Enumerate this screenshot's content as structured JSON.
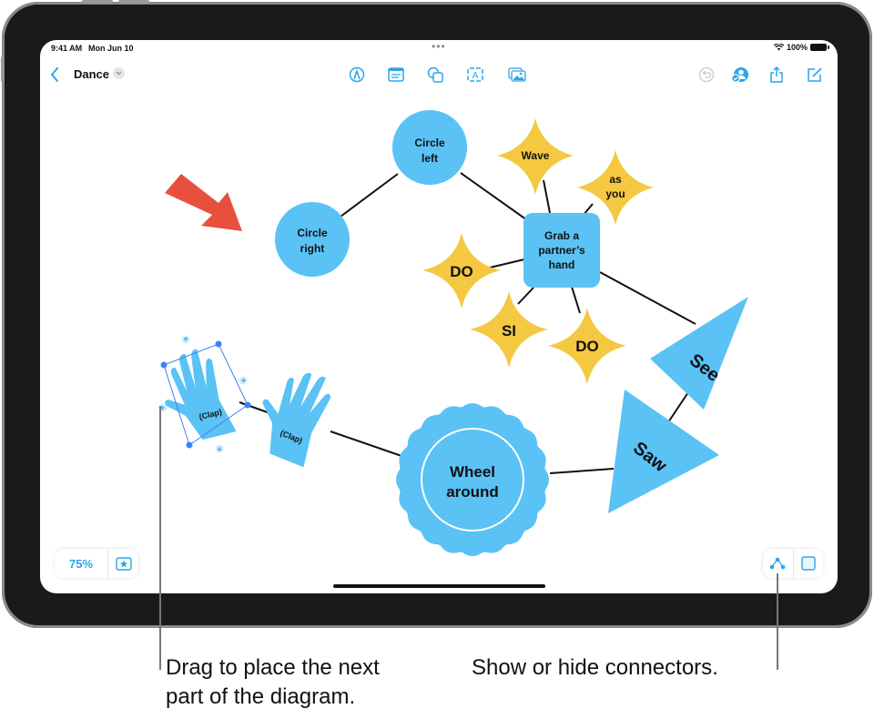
{
  "status_bar": {
    "time": "9:41 AM",
    "date": "Mon Jun 10",
    "battery": "100%",
    "more_dots": "•••"
  },
  "toolbar": {
    "back_icon": "chevron-left-icon",
    "board_title": "Dance",
    "title_menu_icon": "chevron-down-icon",
    "center_tools": [
      "pen-icon",
      "sticky-note-icon",
      "shapes-icon",
      "text-box-icon",
      "media-icon"
    ],
    "right_tools": [
      "undo-icon",
      "collaborate-icon",
      "share-icon",
      "compose-icon"
    ]
  },
  "diagram": {
    "nodes": {
      "circle_left": "Circle left",
      "circle_left_l1": "Circle",
      "circle_left_l2": "left",
      "circle_right_l1": "Circle",
      "circle_right_l2": "right",
      "wave": "Wave",
      "as_you_l1": "as",
      "as_you_l2": "you",
      "grab_l1": "Grab a",
      "grab_l2": "partner’s",
      "grab_l3": "hand",
      "do_1": "DO",
      "si": "SI",
      "do_2": "DO",
      "see": "See",
      "saw": "Saw",
      "wheel_l1": "Wheel",
      "wheel_l2": "around",
      "clap_1": "(Clap)",
      "clap_2": "(Clap)"
    },
    "colors": {
      "blue_shape": "#5ac2f5",
      "yellow_shape": "#f5c842",
      "red_arrow": "#e8503e",
      "selection": "#3b82f6",
      "connector": "#111111"
    }
  },
  "bottom_left": {
    "zoom_level": "75%",
    "favorites_icon": "star-icon"
  },
  "bottom_right": {
    "connectors_icon": "connector-icon",
    "grid_icon": "grid-icon"
  },
  "callouts": {
    "left": "Drag to place the next part of the diagram.",
    "left_l1": "Drag to place the next",
    "left_l2": "part of the diagram.",
    "right": "Show or hide connectors."
  }
}
